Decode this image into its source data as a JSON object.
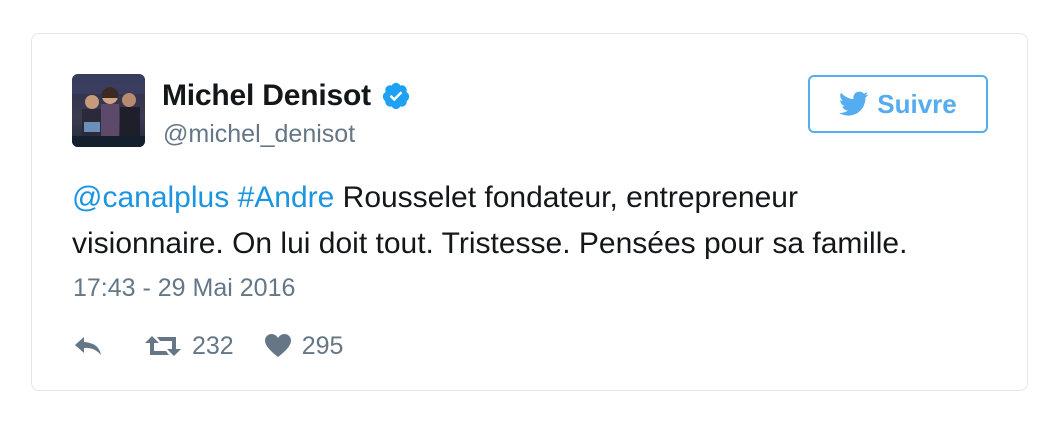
{
  "user": {
    "display_name": "Michel Denisot",
    "handle": "@michel_denisot",
    "verified": true,
    "avatar_icon": "profile-photo"
  },
  "follow_button": {
    "label": "Suivre",
    "icon": "twitter-bird-icon"
  },
  "tweet": {
    "mention": "@canalplus",
    "hashtag": "#Andre",
    "text_line1_rest": " Rousselet fondateur, entrepreneur",
    "text_line2": "visionnaire. On lui doit tout. Tristesse. Pensées pour sa famille.",
    "timestamp": "17:43 - 29 Mai 2016"
  },
  "actions": {
    "reply_icon": "reply-icon",
    "retweet_icon": "retweet-icon",
    "retweet_count": "232",
    "like_icon": "heart-icon",
    "like_count": "295"
  },
  "colors": {
    "link": "#1b95e0",
    "accent": "#55acee",
    "secondary_text": "#657786",
    "primary_text": "#14171a",
    "border": "#e1e8ed"
  }
}
